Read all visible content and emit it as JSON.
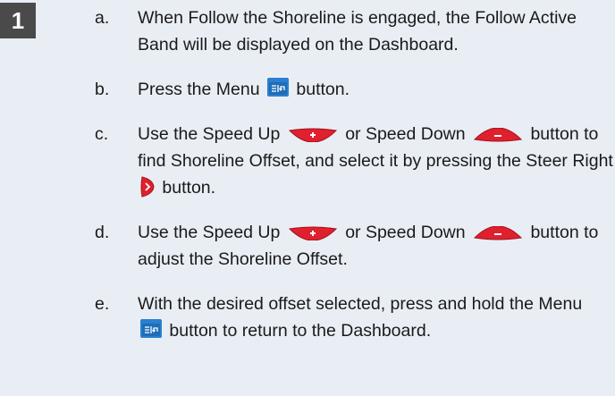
{
  "step_number": "1",
  "items": [
    {
      "letter": "a.",
      "parts": [
        "When Follow the Shoreline is engaged, the Follow Active Band will be displayed on the Dashboard."
      ]
    },
    {
      "letter": "b.",
      "parts": [
        "Press the Menu ",
        " button."
      ]
    },
    {
      "letter": "c.",
      "parts": [
        "Use the Speed Up ",
        " or Speed Down ",
        " button to find Shoreline Offset, and select it by pressing the Steer Right ",
        " button."
      ]
    },
    {
      "letter": "d.",
      "parts": [
        "Use the Speed Up ",
        " or Speed Down ",
        " button to adjust the Shoreline Offset."
      ]
    },
    {
      "letter": "e.",
      "parts": [
        "With the desired offset selected, press and hold the Menu ",
        " button to return to the Dashboard."
      ]
    }
  ],
  "icons": {
    "menu": "menu-button-icon",
    "speed_up": "speed-up-button-icon",
    "speed_down": "speed-down-button-icon",
    "steer_right": "steer-right-button-icon"
  },
  "colors": {
    "background": "#e9eef5",
    "badge": "#4a4a4a",
    "menu_button": "#2a7fd0",
    "speed_button": "#e0202e"
  }
}
